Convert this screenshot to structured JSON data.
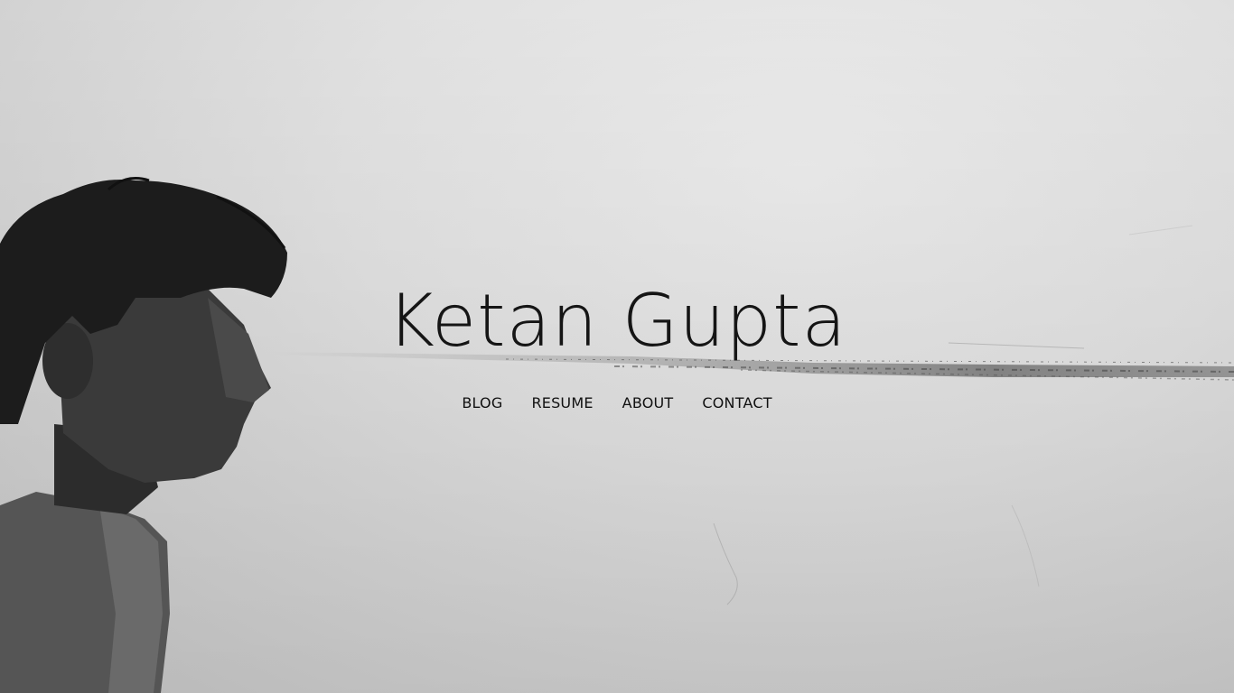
{
  "site": {
    "title": "Ketan Gupta"
  },
  "nav": {
    "items": [
      {
        "label": "BLOG"
      },
      {
        "label": "RESUME"
      },
      {
        "label": "ABOUT"
      },
      {
        "label": "CONTACT"
      }
    ]
  },
  "colors": {
    "background": "#e0e0e0",
    "text": "#151515"
  }
}
